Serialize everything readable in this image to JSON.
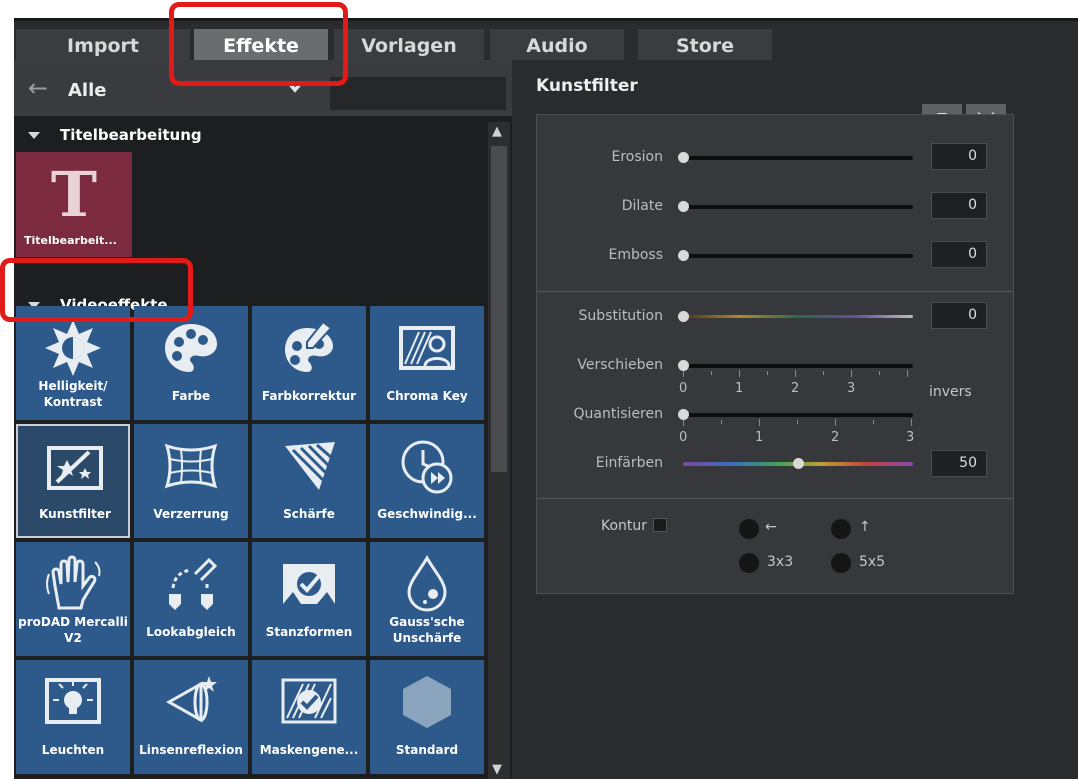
{
  "tabs": [
    {
      "label": "Import",
      "active": false
    },
    {
      "label": "Effekte",
      "active": true
    },
    {
      "label": "Vorlagen",
      "active": false
    },
    {
      "label": "Audio",
      "active": false
    },
    {
      "label": "Store",
      "active": false
    }
  ],
  "left": {
    "category_filter": "Alle",
    "sections": [
      {
        "title": "Titelbearbeitung",
        "tiles": [
          {
            "label": "Titelbearbeit...",
            "icon": "T-letter-icon"
          }
        ]
      },
      {
        "title": "Videoeffekte"
      }
    ],
    "effects": [
      {
        "label": "Helligkeit/ Kontrast",
        "icon": "sun-icon"
      },
      {
        "label": "Farbe",
        "icon": "palette-icon"
      },
      {
        "label": "Farbkorrektur",
        "icon": "palette-brush-icon"
      },
      {
        "label": "Chroma Key",
        "icon": "chroma-person-icon"
      },
      {
        "label": "Kunstfilter",
        "icon": "art-filter-icon",
        "selected": true
      },
      {
        "label": "Verzerrung",
        "icon": "warp-grid-icon"
      },
      {
        "label": "Schärfe",
        "icon": "sharpness-cone-icon"
      },
      {
        "label": "Geschwindig...",
        "icon": "clock-forward-icon"
      },
      {
        "label": "proDAD Mercalli V2",
        "icon": "hand-stabilizer-icon"
      },
      {
        "label": "Lookabgleich",
        "icon": "pipette-match-icon"
      },
      {
        "label": "Stanzformen",
        "icon": "stamp-shape-icon"
      },
      {
        "label": "Gauss'sche Unschärfe",
        "icon": "drop-blur-icon"
      },
      {
        "label": "Leuchten",
        "icon": "glow-bulb-icon"
      },
      {
        "label": "Linsenreflexion",
        "icon": "lens-flare-icon"
      },
      {
        "label": "Maskengene...",
        "icon": "mask-generator-icon"
      },
      {
        "label": "Standard",
        "icon": "hexagon-icon"
      }
    ]
  },
  "right": {
    "title": "Kunstfilter",
    "buttons": [
      {
        "icon": "triangle-down-icon"
      },
      {
        "icon": "collapse-arrows-icon"
      }
    ],
    "params": [
      {
        "label": "Erosion",
        "value": "0",
        "level": 0
      },
      {
        "label": "Dilate",
        "value": "0",
        "level": 0
      },
      {
        "label": "Emboss",
        "value": "0",
        "level": 0
      },
      {
        "label": "Substitution",
        "value": "0",
        "level": 0
      },
      {
        "label": "Verschieben",
        "level": 0,
        "scale": [
          "0",
          "1",
          "2",
          "3"
        ]
      },
      {
        "label": "Quantisieren",
        "level": 0,
        "scale": [
          "0",
          "1",
          "2",
          "3"
        ]
      },
      {
        "label": "Einfärben",
        "value": "50",
        "level": 0.5
      }
    ],
    "invers_label": "invers",
    "contour_label": "Kontur",
    "radio_options": [
      "←",
      "↑",
      "3x3",
      "5x5"
    ]
  },
  "colors": {
    "highlight": "#e31a1a",
    "tile_blue": "#2d5a8b",
    "title_tile": "#7b2a3f"
  }
}
